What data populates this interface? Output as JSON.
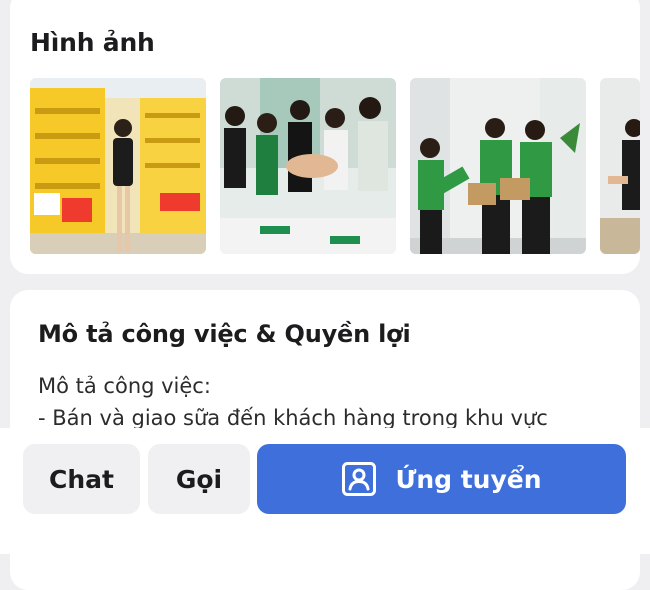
{
  "images_section": {
    "title": "Hình ảnh",
    "photos": [
      {
        "icon": "store-interior-photo"
      },
      {
        "icon": "team-hands-together-photo"
      },
      {
        "icon": "staff-with-boxes-photo"
      },
      {
        "icon": "staff-partial-photo"
      }
    ]
  },
  "description_section": {
    "title": "Mô tả công việc & Quyền lợi",
    "lines": [
      "Mô tả công việc:",
      "- Bán và giao sữa đến khách hàng trong khu vực"
    ]
  },
  "actions": {
    "chat_label": "Chat",
    "call_label": "Gọi",
    "apply_label": "Ứng tuyển",
    "apply_icon": "profile-card-icon"
  },
  "colors": {
    "primary": "#3e6fdb",
    "secondary_button": "#f0f0f2",
    "background": "#efeff2"
  }
}
